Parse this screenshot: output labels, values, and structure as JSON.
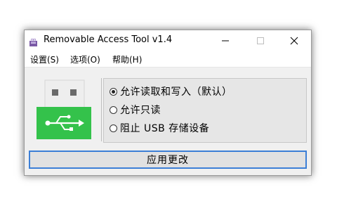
{
  "window": {
    "title": "Removable Access Tool v1.4",
    "icon": "usb-drive-icon"
  },
  "titlebar_buttons": {
    "minimize_icon": "minimize-icon",
    "maximize_icon": "maximize-icon",
    "close_icon": "close-icon"
  },
  "menu": {
    "items": [
      {
        "label": "设置(S)"
      },
      {
        "label": "选项(O)"
      },
      {
        "label": "帮助(H)"
      }
    ]
  },
  "usb_graphic": {
    "icon": "usb-symbol-icon",
    "plug_color": "#eeeeee",
    "body_color": "#34c24b"
  },
  "options": [
    {
      "label": "允许读取和写入（默认）",
      "selected": true
    },
    {
      "label": "允许只读",
      "selected": false
    },
    {
      "label": "阻止 USB 存储设备",
      "selected": false
    }
  ],
  "apply_button": {
    "label": "应用更改",
    "accent": "#3c7fd6"
  }
}
